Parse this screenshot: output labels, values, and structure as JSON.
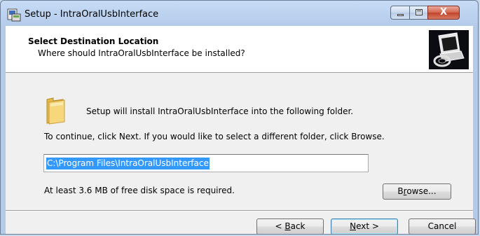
{
  "window": {
    "title": "Setup - IntraOralUsbInterface",
    "close_glyph": "X"
  },
  "header": {
    "title": "Select Destination Location",
    "subtitle": "Where should IntraOralUsbInterface be installed?"
  },
  "body": {
    "intro": "Setup will install IntraOralUsbInterface into the following folder.",
    "continue": "To continue, click Next. If you would like to select a different folder, click Browse.",
    "path_value": "C:\\Program Files\\IntraOralUsbInterface",
    "browse_prefix": "B",
    "browse_ul": "r",
    "browse_rest": "owse...",
    "disk_space": "At least 3.6 MB of free disk space is required."
  },
  "footer": {
    "back_prefix": "< ",
    "back_ul": "B",
    "back_rest": "ack",
    "next_ul": "N",
    "next_rest": "ext >",
    "cancel": "Cancel"
  },
  "colors": {
    "selection": "#3399ff",
    "close_button": "#c2432a"
  }
}
